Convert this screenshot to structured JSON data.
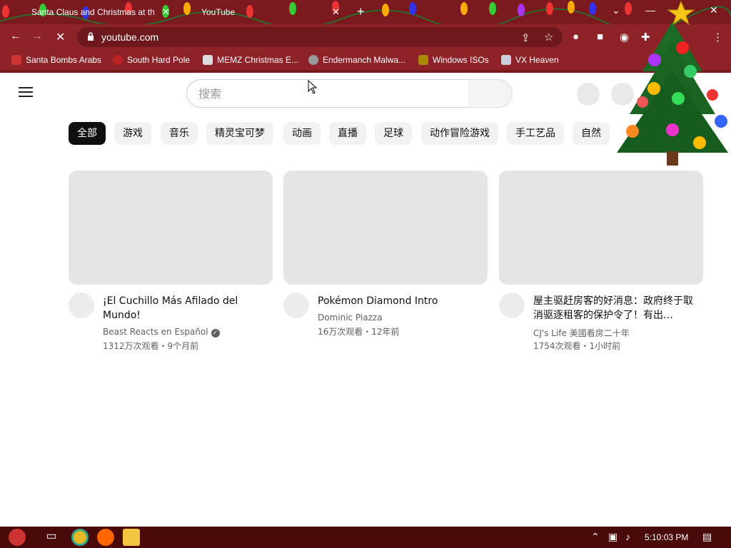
{
  "browser": {
    "tabs": [
      {
        "label": "Santa Claus and Christmas at the",
        "active": false
      },
      {
        "label": "YouTube",
        "active": true
      }
    ],
    "url": "youtube.com",
    "bookmarks": [
      {
        "label": "Santa Bombs Arabs"
      },
      {
        "label": "South Hard Pole"
      },
      {
        "label": "MEMZ Christmas E..."
      },
      {
        "label": "Endermanch Malwa..."
      },
      {
        "label": "Windows ISOs"
      },
      {
        "label": "VX Heaven"
      }
    ]
  },
  "youtube": {
    "search_placeholder": "搜索",
    "chips": [
      "全部",
      "游戏",
      "音乐",
      "精灵宝可梦",
      "动画",
      "直播",
      "足球",
      "动作冒险游戏",
      "手工艺品",
      "自然"
    ],
    "videos": [
      {
        "title": "¡El Cuchillo Más Afilado del Mundo!",
        "channel": "Beast Reacts en Español",
        "verified": true,
        "stats": "1312万次观看・9个月前"
      },
      {
        "title": "Pokémon Diamond Intro",
        "channel": "Dominic Piazza",
        "verified": false,
        "stats": "16万次观看・12年前"
      },
      {
        "title": "屋主驱赶房客的好消息：政府终于取消驱逐租客的保护令了！有出…",
        "channel": "CJ's Life 美國看房二十年",
        "verified": false,
        "stats": "1754次观看・1小时前"
      }
    ]
  },
  "taskbar": {
    "time": "5:10:03 PM"
  },
  "colors": {
    "chrome_frame": "#8d2229",
    "chip_active": "#0f0f0f"
  }
}
